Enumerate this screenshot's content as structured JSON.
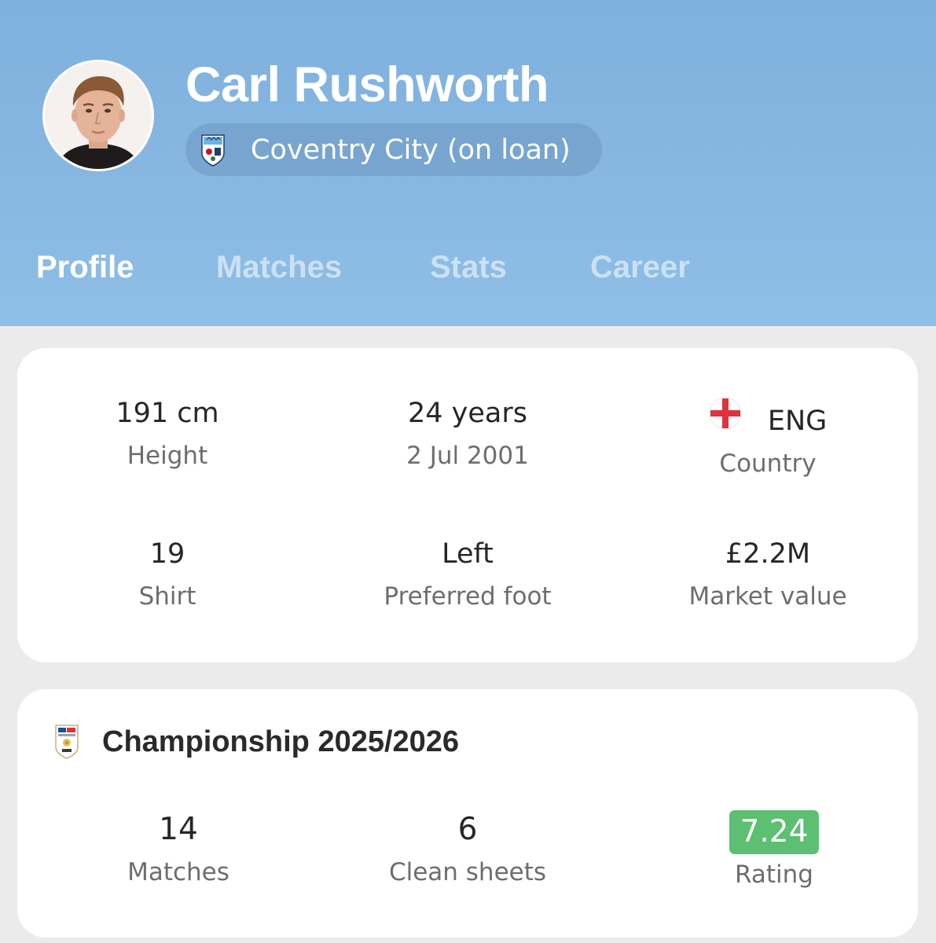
{
  "player": {
    "name": "Carl Rushworth",
    "team": "Coventry City (on loan)"
  },
  "tabs": [
    {
      "label": "Profile",
      "active": true
    },
    {
      "label": "Matches",
      "active": false
    },
    {
      "label": "Stats",
      "active": false
    },
    {
      "label": "Career",
      "active": false
    }
  ],
  "info": {
    "height": {
      "value": "191 cm",
      "label": "Height"
    },
    "age": {
      "value": "24 years",
      "label": "2 Jul 2001"
    },
    "country": {
      "value": "ENG",
      "label": "Country",
      "flag_icon": "england-flag-icon"
    },
    "shirt": {
      "value": "19",
      "label": "Shirt"
    },
    "foot": {
      "value": "Left",
      "label": "Preferred foot"
    },
    "market": {
      "value": "£2.2M",
      "label": "Market value"
    }
  },
  "league": {
    "title": "Championship 2025/2026",
    "logo_icon": "efl-championship-logo-icon",
    "matches": {
      "value": "14",
      "label": "Matches"
    },
    "clean_sheets": {
      "value": "6",
      "label": "Clean sheets"
    },
    "rating": {
      "value": "7.24",
      "label": "Rating",
      "color": "#5cbf71"
    }
  },
  "colors": {
    "header": "#7eb1de",
    "background": "#ebebeb",
    "card": "#ffffff"
  }
}
